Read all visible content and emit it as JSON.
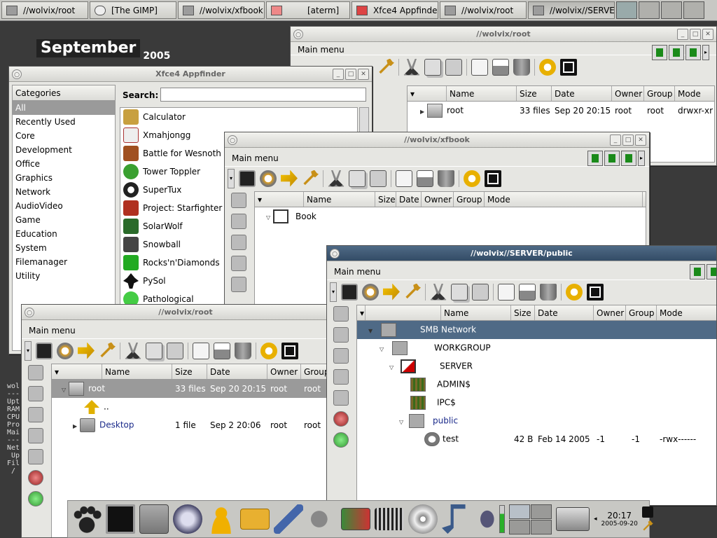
{
  "taskbar": {
    "tasks": [
      {
        "label": "//wolvix/root"
      },
      {
        "label": "[The GIMP]"
      },
      {
        "label": "//wolvix/xfbook"
      },
      {
        "label": "[aterm]"
      },
      {
        "label": "Xfce4 Appfinder"
      },
      {
        "label": "//wolvix/root"
      },
      {
        "label": "//wolvix//SERVER/p"
      }
    ]
  },
  "desktop": {
    "calendar_month": "September",
    "calendar_year": "2005",
    "terminal_text": "wol\n---\nUpt\nRAM\nCPU\nPro\nMai\n---\nNet\n Up\nFil\n /"
  },
  "win_root_back": {
    "title": "//wolvix/root",
    "main_menu": "Main menu",
    "columns": [
      "Name",
      "Size",
      "Date",
      "Owner",
      "Group",
      "Mode"
    ],
    "rows": [
      {
        "name": "root",
        "size": "33 files",
        "date": "Sep 20 20:15",
        "owner": "root",
        "group": "root",
        "mode": "drwxr-xr"
      }
    ]
  },
  "appfinder": {
    "title": "Xfce4 Appfinder",
    "categories_header": "Categories",
    "categories": [
      "All",
      "Recently Used",
      "Core",
      "Development",
      "Office",
      "Graphics",
      "Network",
      "AudioVideo",
      "Game",
      "Education",
      "System",
      "Filemanager",
      "Utility"
    ],
    "search_label": "Search:",
    "search_value": "",
    "apps": [
      "Calculator",
      "Xmahjongg",
      "Battle for Wesnoth",
      "Tower Toppler",
      "SuperTux",
      "Project: Starfighter",
      "SolarWolf",
      "Snowball",
      "Rocks'n'Diamonds",
      "PySol",
      "Pathological"
    ],
    "app_colors": [
      "#c8a040",
      "#e8e8e8",
      "#a05020",
      "#3aa030",
      "#ffcc00",
      "#b03020",
      "#2a6a2a",
      "#444444",
      "#22aa22",
      "#111111",
      "#44cc44"
    ]
  },
  "win_xfbook": {
    "title": "//wolvix/xfbook",
    "main_menu": "Main menu",
    "columns": [
      "Name",
      "Size",
      "Date",
      "Owner",
      "Group",
      "Mode"
    ],
    "rows": [
      {
        "name": "Book"
      }
    ]
  },
  "win_root_front": {
    "title": "//wolvix/root",
    "main_menu": "Main menu",
    "columns": [
      "Name",
      "Size",
      "Date",
      "Owner",
      "Group"
    ],
    "rows": [
      {
        "name": "root",
        "size": "33 files",
        "date": "Sep 20 20:15",
        "owner": "root",
        "group": "root"
      },
      {
        "name": "..",
        "size": "",
        "date": "",
        "owner": "",
        "group": ""
      },
      {
        "name": "Desktop",
        "size": "1 file",
        "date": "Sep  2 20:06",
        "owner": "root",
        "group": "root"
      }
    ]
  },
  "win_smb": {
    "title": "//wolvix//SERVER/public",
    "main_menu": "Main menu",
    "columns": [
      "Name",
      "Size",
      "Date",
      "Owner",
      "Group",
      "Mode"
    ],
    "rows": [
      {
        "name": "SMB Network",
        "size": "",
        "date": "",
        "owner": "",
        "group": "",
        "mode": ""
      },
      {
        "name": "WORKGROUP",
        "size": "",
        "date": "",
        "owner": "",
        "group": "",
        "mode": ""
      },
      {
        "name": "SERVER",
        "size": "",
        "date": "",
        "owner": "",
        "group": "",
        "mode": ""
      },
      {
        "name": "ADMIN$",
        "size": "",
        "date": "",
        "owner": "",
        "group": "",
        "mode": ""
      },
      {
        "name": "IPC$",
        "size": "",
        "date": "",
        "owner": "",
        "group": "",
        "mode": ""
      },
      {
        "name": "public",
        "size": "",
        "date": "",
        "owner": "",
        "group": "",
        "mode": ""
      },
      {
        "name": "test",
        "size": "42 B",
        "date": "Feb 14  2005",
        "owner": "-1",
        "group": "-1",
        "mode": "-rwx------"
      }
    ]
  },
  "panel": {
    "clock_time": "20:17",
    "clock_date": "2005-09-20"
  }
}
